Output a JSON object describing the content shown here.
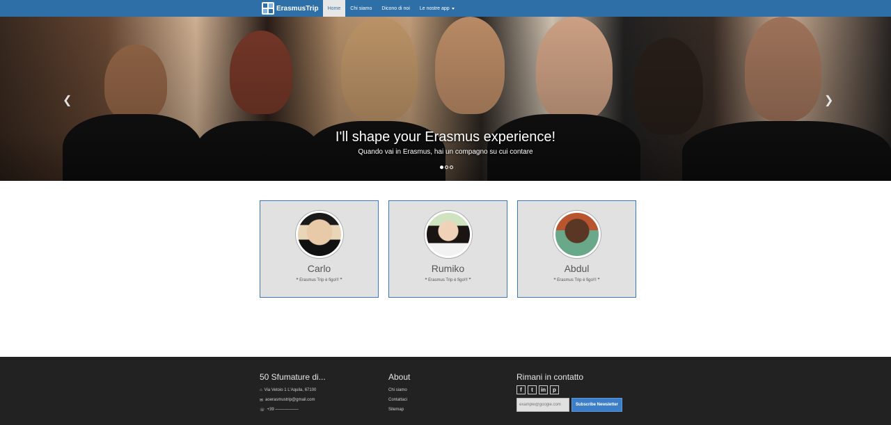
{
  "nav": {
    "brand": "ErasmusTrip",
    "items": [
      {
        "label": "Home",
        "active": true
      },
      {
        "label": "Chi siamo"
      },
      {
        "label": "Dicono di noi"
      },
      {
        "label": "Le nostre app",
        "dropdown": true
      }
    ]
  },
  "hero": {
    "title": "I'll shape your Erasmus experience!",
    "subtitle": "Quando vai in Erasmus, hai un compagno su cui contare",
    "prev_icon": "chevron-left-icon",
    "next_icon": "chevron-right-icon",
    "slide_count": 3,
    "active_slide": 1
  },
  "testimonials": [
    {
      "name": "Carlo",
      "quote": "Erasmus Trip è figo!!!"
    },
    {
      "name": "Rumiko",
      "quote": "Erasmus Trip è figo!!!"
    },
    {
      "name": "Abdul",
      "quote": "Erasmus Trip è figo!!!"
    }
  ],
  "footer": {
    "col1": {
      "title": "50 Sfumature di...",
      "address": "Via Vetoio 1 L'Aquila, 67100",
      "email": "aoerasmustrip@gmail.com",
      "phone": "+39 ––––––––––"
    },
    "col2": {
      "title": "About",
      "links": [
        "Chi siamo",
        "Contattaci",
        "Sitemap"
      ]
    },
    "col3": {
      "title": "Rimani in contatto",
      "social": [
        "facebook-icon",
        "twitter-icon",
        "linkedin-icon",
        "pinterest-icon"
      ],
      "newsletter_placeholder": "example@google.com",
      "newsletter_button": "Subscribe Newsletter"
    }
  },
  "colors": {
    "navbar": "#2f6fa7",
    "card_border": "#3a78b5",
    "footer": "#222222",
    "button": "#3c7fc8"
  }
}
